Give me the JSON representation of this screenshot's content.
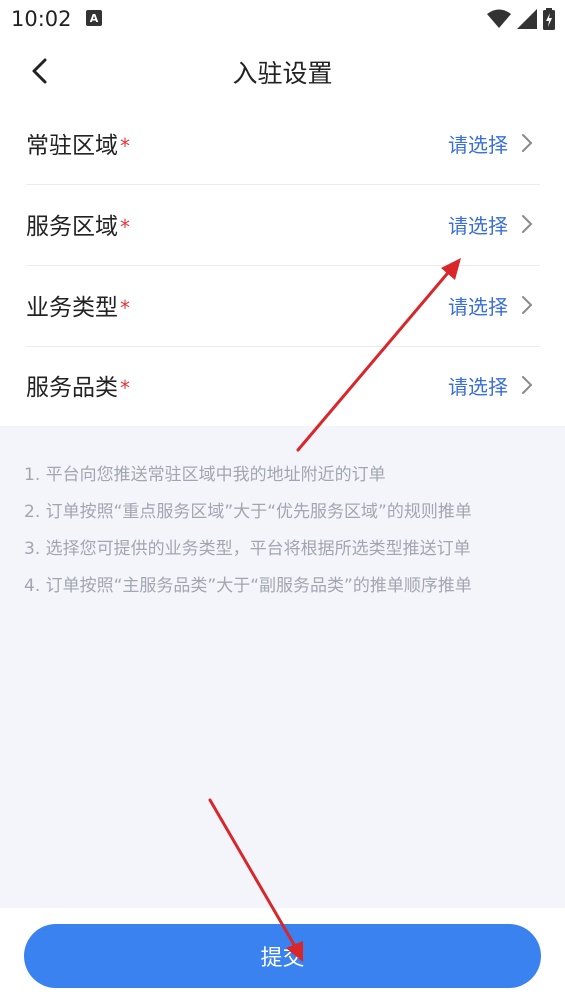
{
  "status_bar": {
    "time": "10:02",
    "notification_icon": "A",
    "icons": [
      "wifi-icon",
      "cellular-signal-icon",
      "battery-icon"
    ]
  },
  "header": {
    "back_icon": "chevron-left-icon",
    "title": "入驻设置"
  },
  "form": {
    "rows": [
      {
        "label": "常驻区域",
        "required_mark": "*",
        "value": "请选择"
      },
      {
        "label": "服务区域",
        "required_mark": "*",
        "value": "请选择"
      },
      {
        "label": "业务类型",
        "required_mark": "*",
        "value": "请选择"
      },
      {
        "label": "服务品类",
        "required_mark": "*",
        "value": "请选择"
      }
    ]
  },
  "notes": [
    "1. 平台向您推送常驻区域中我的地址附近的订单",
    "2. 订单按照“重点服务区域”大于“优先服务区域”的规则推单",
    "3. 选择您可提供的业务类型，平台将根据所选类型推送订单",
    "4. 订单按照“主服务品类”大于“副服务品类”的推单顺序推单"
  ],
  "submit": {
    "label": "提交"
  },
  "colors": {
    "accent": "#3b82f1",
    "link": "#3a6fd9",
    "required": "#e8363a",
    "annotation_arrow": "#d9262a"
  }
}
